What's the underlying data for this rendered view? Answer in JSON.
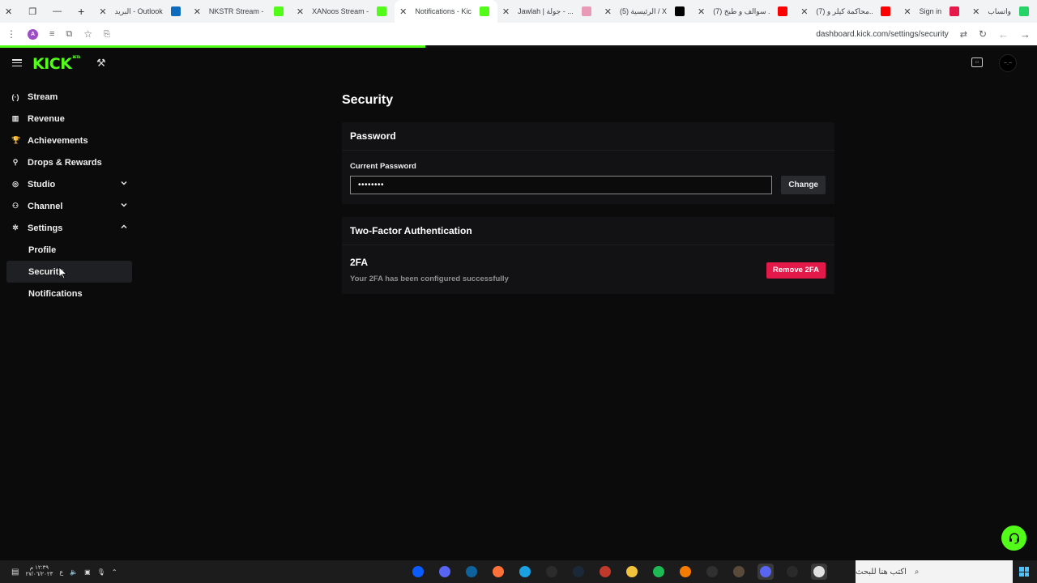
{
  "browser": {
    "tabs": [
      {
        "title": "واتساب",
        "favicon": "whatsapp-icon",
        "color": "#25d366",
        "active": false
      },
      {
        "title": "Sign in",
        "favicon": "chevron-right-icon",
        "color": "#e6194b",
        "active": false
      },
      {
        "title": "(7) محاكمة كيلر و...",
        "favicon": "youtube-icon",
        "color": "#ff0000",
        "active": false
      },
      {
        "title": "(7) سوالف و طبخ ...",
        "favicon": "youtube-icon",
        "color": "#ff0000",
        "active": false
      },
      {
        "title": "(5) الرئيسية / X",
        "favicon": "x-icon",
        "color": "#000000",
        "active": false
      },
      {
        "title": "Jawlah | جولة - ...",
        "favicon": "jawlah-icon",
        "color": "#e89ab7",
        "active": false
      },
      {
        "title": "Notifications - Kic",
        "favicon": "kick-icon",
        "color": "#53fc18",
        "active": true
      },
      {
        "title": "XANoos Stream - ...",
        "favicon": "kick-icon",
        "color": "#53fc18",
        "active": false
      },
      {
        "title": "NKSTR Stream - V",
        "favicon": "kick-icon",
        "color": "#53fc18",
        "active": false
      },
      {
        "title": "البريد - Outlook",
        "favicon": "outlook-icon",
        "color": "#0f6cbd",
        "active": false
      }
    ],
    "new_tab_label": "+",
    "url": "dashboard.kick.com/settings/security",
    "profile_initial": "A",
    "load_progress_percent": 41
  },
  "app": {
    "logo_text": "KICK",
    "logo_badge": "BETA",
    "avatar_text": "~.~",
    "theme": {
      "accent": "#53fc18",
      "danger": "#e3194a"
    }
  },
  "sidebar": {
    "items": [
      {
        "label": "Stream",
        "icon": "broadcast-icon",
        "glyph": "(·)",
        "chevron": "none"
      },
      {
        "label": "Revenue",
        "icon": "revenue-icon",
        "glyph": "▥",
        "chevron": "none"
      },
      {
        "label": "Achievements",
        "icon": "trophy-icon",
        "glyph": "🏆",
        "chevron": "none"
      },
      {
        "label": "Drops & Rewards",
        "icon": "drops-icon",
        "glyph": "⚲",
        "chevron": "none"
      },
      {
        "label": "Studio",
        "icon": "studio-icon",
        "glyph": "◎",
        "chevron": "down"
      },
      {
        "label": "Channel",
        "icon": "channel-icon",
        "glyph": "⚇",
        "chevron": "down"
      },
      {
        "label": "Settings",
        "icon": "gear-icon",
        "glyph": "✲",
        "chevron": "up"
      }
    ],
    "sub_items": [
      {
        "label": "Profile",
        "active": false
      },
      {
        "label": "Security",
        "active": true
      },
      {
        "label": "Notifications",
        "active": false
      }
    ]
  },
  "page": {
    "title": "Security",
    "password": {
      "section_title": "Password",
      "field_label": "Current Password",
      "field_value": "••••••••",
      "change_label": "Change"
    },
    "two_factor": {
      "section_title": "Two-Factor Authentication",
      "item_title": "2FA",
      "status_text": "Your 2FA has been configured successfully",
      "remove_label": "Remove 2FA"
    }
  },
  "taskbar": {
    "clock_time": "١٢:٣٩ م",
    "clock_date": "٢٧/٠٦/٢٠٢٣",
    "keyboard_lang": "ع",
    "search_placeholder": "اكتب هنا للبحث",
    "apps": [
      {
        "icon": "chat-icon",
        "color": "#0b5cff"
      },
      {
        "icon": "mic-app-icon",
        "color": "#5865f2"
      },
      {
        "icon": "vscode-icon",
        "color": "#0e639c"
      },
      {
        "icon": "firefox-icon",
        "color": "#ff7139"
      },
      {
        "icon": "edge-icon",
        "color": "#1ba0e2"
      },
      {
        "icon": "sync-icon",
        "color": "#2b2b2b"
      },
      {
        "icon": "steam-icon",
        "color": "#1b2838"
      },
      {
        "icon": "voicemeeter-icon",
        "color": "#c0392b"
      },
      {
        "icon": "folder-icon",
        "color": "#f3c23c"
      },
      {
        "icon": "spotify-icon",
        "color": "#1db954"
      },
      {
        "icon": "aimp-icon",
        "color": "#f57c00"
      },
      {
        "icon": "obs-icon",
        "color": "#303030"
      },
      {
        "icon": "game-icon",
        "color": "#5a4a3a"
      },
      {
        "icon": "discord-icon",
        "color": "#5865f2"
      },
      {
        "icon": "epic-icon",
        "color": "#2a2a2a"
      },
      {
        "icon": "chrome-icon",
        "color": "#e0e0e0"
      },
      {
        "icon": "taskview-icon",
        "color": "#1c1c1c"
      }
    ]
  }
}
